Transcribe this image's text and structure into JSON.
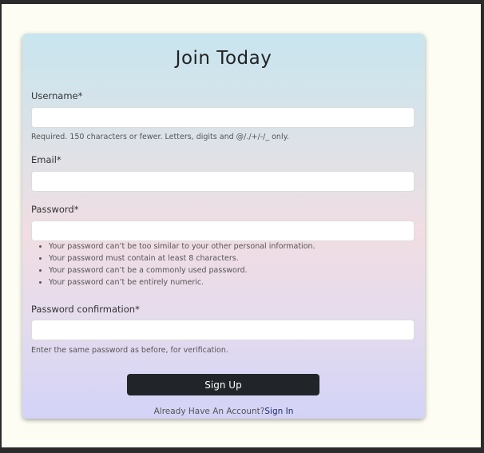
{
  "form": {
    "title": "Join Today",
    "username": {
      "label": "Username*",
      "value": "",
      "help": "Required. 150 characters or fewer. Letters, digits and @/./+/-/_ only."
    },
    "email": {
      "label": "Email*",
      "value": ""
    },
    "password": {
      "label": "Password*",
      "value": "",
      "rules": [
        "Your password can’t be too similar to your other personal information.",
        "Your password must contain at least 8 characters.",
        "Your password can’t be a commonly used password.",
        "Your password can’t be entirely numeric."
      ]
    },
    "password_confirmation": {
      "label": "Password confirmation*",
      "value": "",
      "help": "Enter the same password as before, for verification."
    },
    "submit_label": "Sign Up",
    "footer": {
      "prompt": "Already Have An Account?",
      "link_label": "Sign In"
    }
  },
  "colors": {
    "button_bg": "#212529",
    "link": "#1f2f6b",
    "page_bg": "#fdfdf3"
  }
}
